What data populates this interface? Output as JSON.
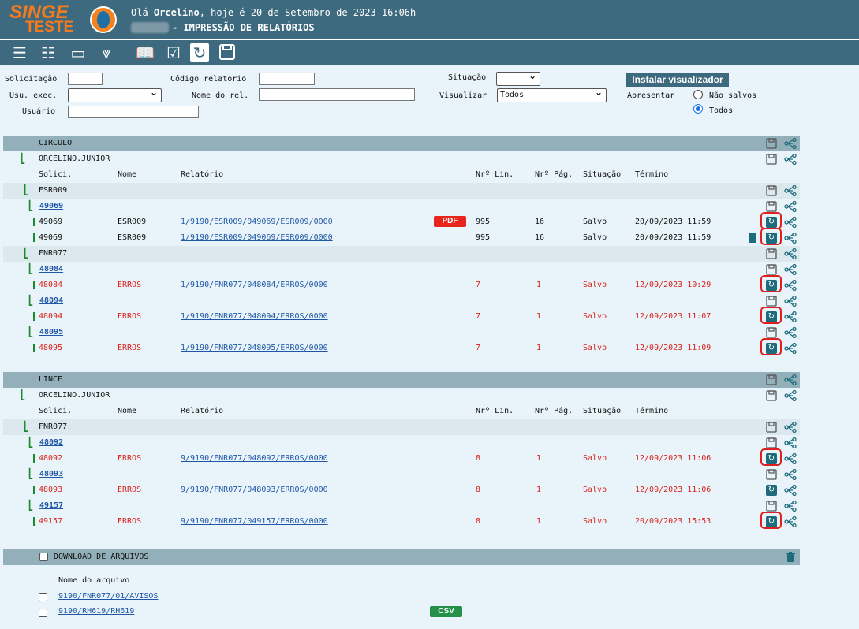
{
  "header": {
    "logo_top": "SINGE",
    "logo_bottom": "TESTE",
    "greeting_prefix": "Olá ",
    "user_name": "Orcelino",
    "greeting_suffix": ", hoje é 20 de Setembro de 2023 16:06h",
    "module_title": "- IMPRESSÃO DE RELATÓRIOS",
    "brand_color": "#3d6a7e",
    "logo_color": "#f47a20"
  },
  "toolbar": {
    "icons": [
      "list-icon",
      "checklist-icon",
      "form-icon",
      "collapse-icon",
      "book-icon",
      "check-list-icon",
      "refresh-icon",
      "save-icon"
    ]
  },
  "filters": {
    "solicitacao_label": "Solicitação",
    "solicitacao_value": "",
    "codigo_label": "Código relatorio",
    "codigo_value": "",
    "situacao_label": "Situação",
    "situacao_value": "",
    "usu_exec_label": "Usu. exec.",
    "usu_exec_value": "",
    "nome_rel_label": "Nome do rel.",
    "nome_rel_value": "",
    "visualizar_label": "Visualizar",
    "visualizar_value": "Todos",
    "usuario_label": "Usuário",
    "usuario_value": "",
    "install_button": "Instalar visualizador",
    "apresentar_label": "Apresentar",
    "opt_nao_salvos": "Não salvos",
    "opt_todos": "Todos",
    "apresentar_selected": "Todos"
  },
  "columns": {
    "solici": "Solici.",
    "nome": "Nome",
    "relatorio": "Relatório",
    "nr_lin": "Nrº Lin.",
    "nr_pag": "Nrº Pág.",
    "situacao": "Situação",
    "termino": "Término"
  },
  "groups": {
    "circulo": {
      "name": "CIRCULO",
      "user": "ORCELINO.JUNIOR",
      "esr009": {
        "name": "ESR009",
        "req": "49069",
        "rows": [
          {
            "solici": "49069",
            "nome": "ESR009",
            "relatorio": "1/9190/ESR009/049069/ESR009/0000",
            "badge": "PDF",
            "lin": "995",
            "pag": "16",
            "situacao": "Salvo",
            "termino": "20/09/2023 11:59"
          },
          {
            "solici": "49069",
            "nome": "ESR009",
            "relatorio": "1/9190/ESR009/049069/ESR009/0000",
            "lin": "995",
            "pag": "16",
            "situacao": "Salvo",
            "termino": "20/09/2023 11:59"
          }
        ]
      },
      "fnr077": {
        "name": "FNR077",
        "reqs": [
          {
            "req": "48084",
            "solici": "48084",
            "nome": "ERROS",
            "relatorio": "1/9190/FNR077/048084/ERROS/0000",
            "lin": "7",
            "pag": "1",
            "situacao": "Salvo",
            "termino": "12/09/2023 10:29"
          },
          {
            "req": "48094",
            "solici": "48094",
            "nome": "ERROS",
            "relatorio": "1/9190/FNR077/048094/ERROS/0000",
            "lin": "7",
            "pag": "1",
            "situacao": "Salvo",
            "termino": "12/09/2023 11:07"
          },
          {
            "req": "48095",
            "solici": "48095",
            "nome": "ERROS",
            "relatorio": "1/9190/FNR077/048095/ERROS/0000",
            "lin": "7",
            "pag": "1",
            "situacao": "Salvo",
            "termino": "12/09/2023 11:09"
          }
        ]
      }
    },
    "lince": {
      "name": "LINCE",
      "user": "ORCELINO.JUNIOR",
      "fnr077": {
        "name": "FNR077",
        "reqs": [
          {
            "req": "48092",
            "solici": "48092",
            "nome": "ERROS",
            "relatorio": "9/9190/FNR077/048092/ERROS/0000",
            "lin": "8",
            "pag": "1",
            "situacao": "Salvo",
            "termino": "12/09/2023 11:06"
          },
          {
            "req": "48093",
            "solici": "48093",
            "nome": "ERROS",
            "relatorio": "9/9190/FNR077/048093/ERROS/0000",
            "lin": "8",
            "pag": "1",
            "situacao": "Salvo",
            "termino": "12/09/2023 11:06"
          },
          {
            "req": "49157",
            "solici": "49157",
            "nome": "ERROS",
            "relatorio": "9/9190/FNR077/049157/ERROS/0000",
            "lin": "8",
            "pag": "1",
            "situacao": "Salvo",
            "termino": "20/09/2023 15:53"
          }
        ]
      }
    }
  },
  "downloads": {
    "title": "DOWNLOAD DE ARQUIVOS",
    "col_nome": "Nome do arquivo",
    "files": [
      {
        "name": "9190/FNR077/01/AVISOS"
      },
      {
        "name": "9190/RH619/RH619",
        "badge": "CSV"
      }
    ]
  },
  "colors": {
    "error_text": "#d9231c",
    "link": "#1f57a6",
    "tree": "#1d8a2e",
    "highlight": "#e02020",
    "pdf": "#e8251d",
    "csv": "#259048"
  }
}
